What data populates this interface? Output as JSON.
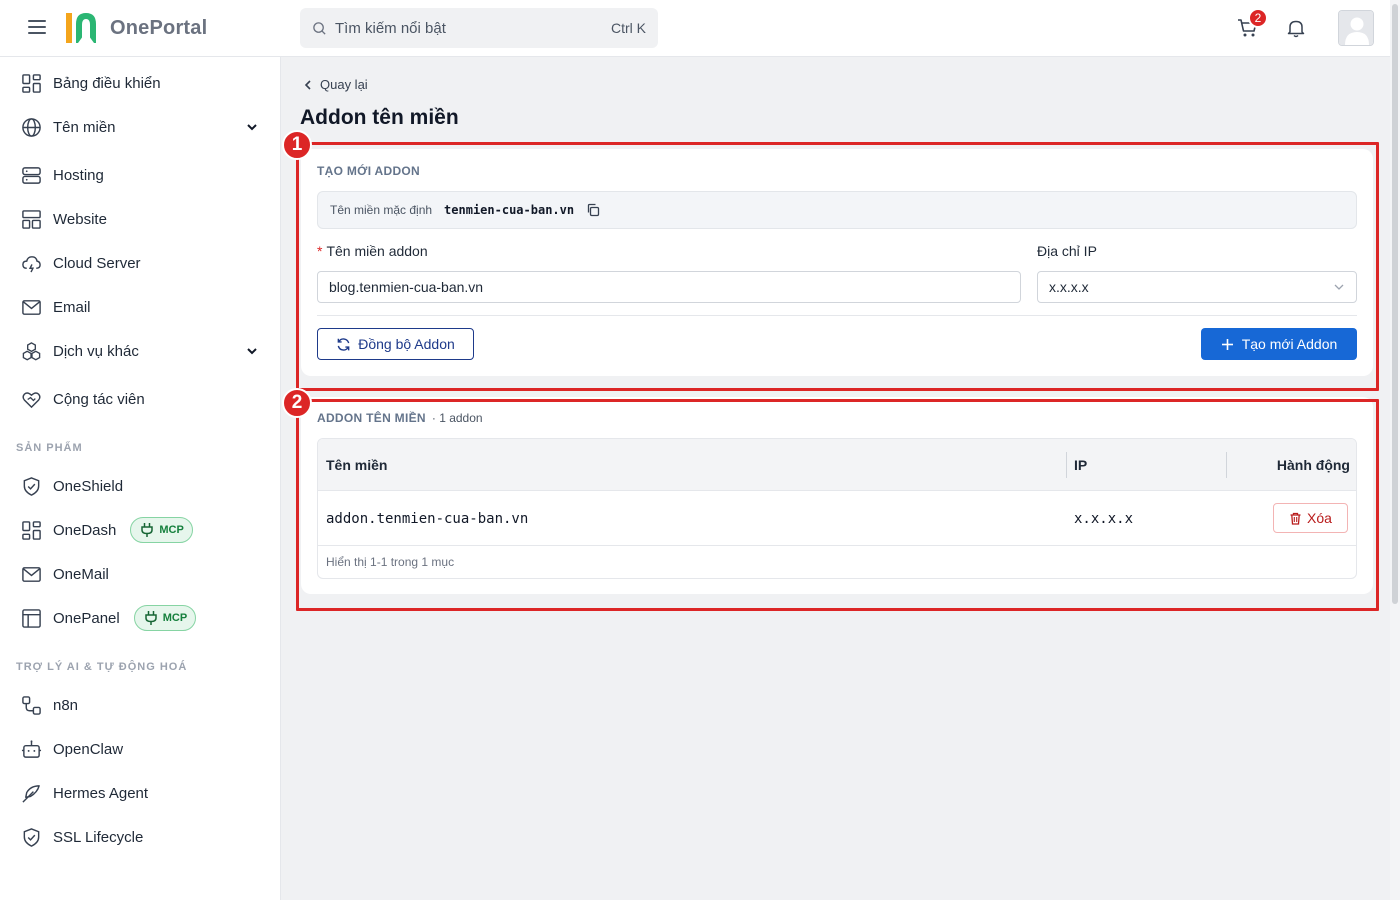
{
  "header": {
    "logo_text": "OnePortal",
    "search_placeholder": "Tìm kiếm nổi bật",
    "search_shortcut": "Ctrl K",
    "cart_count": "2"
  },
  "sidebar": {
    "items": [
      {
        "label": "Bảng điều khiển"
      },
      {
        "label": "Tên miền"
      },
      {
        "label": "Hosting"
      },
      {
        "label": "Website"
      },
      {
        "label": "Cloud Server"
      },
      {
        "label": "Email"
      },
      {
        "label": "Dịch vụ khác"
      },
      {
        "label": "Cộng tác viên"
      }
    ],
    "section_products": "SẢN PHẨM",
    "products": [
      {
        "label": "OneShield"
      },
      {
        "label": "OneDash",
        "badge": "MCP"
      },
      {
        "label": "OneMail"
      },
      {
        "label": "OnePanel",
        "badge": "MCP"
      }
    ],
    "section_ai": "TRỢ LÝ AI & TỰ ĐỘNG HOÁ",
    "ai": [
      {
        "label": "n8n"
      },
      {
        "label": "OpenClaw"
      },
      {
        "label": "Hermes Agent"
      },
      {
        "label": "SSL Lifecycle"
      }
    ]
  },
  "main": {
    "back_label": "Quay lại",
    "title": "Addon tên miền",
    "create_card": {
      "heading": "TẠO MỚI ADDON",
      "default_label": "Tên miền mặc định",
      "default_value": "tenmien-cua-ban.vn",
      "required_mark": "*",
      "addon_label": "Tên miền addon",
      "addon_value": "blog.tenmien-cua-ban.vn",
      "ip_label": "Địa chỉ IP",
      "ip_value": "x.x.x.x",
      "sync_button": "Đồng bộ Addon",
      "create_button": "Tạo mới Addon"
    },
    "list_card": {
      "heading": "ADDON TÊN MIỀN",
      "count": "· 1 addon",
      "columns": [
        "Tên miền",
        "IP",
        "Hành động"
      ],
      "rows": [
        {
          "domain": "addon.tenmien-cua-ban.vn",
          "ip": "x.x.x.x",
          "action": "Xóa"
        }
      ],
      "footer": "Hiển thị 1-1 trong 1 mục"
    }
  },
  "annotations": [
    "1",
    "2"
  ],
  "colors": {
    "primary": "#1768d6",
    "danger": "#dc2626",
    "mcp_green": "#15803d"
  }
}
